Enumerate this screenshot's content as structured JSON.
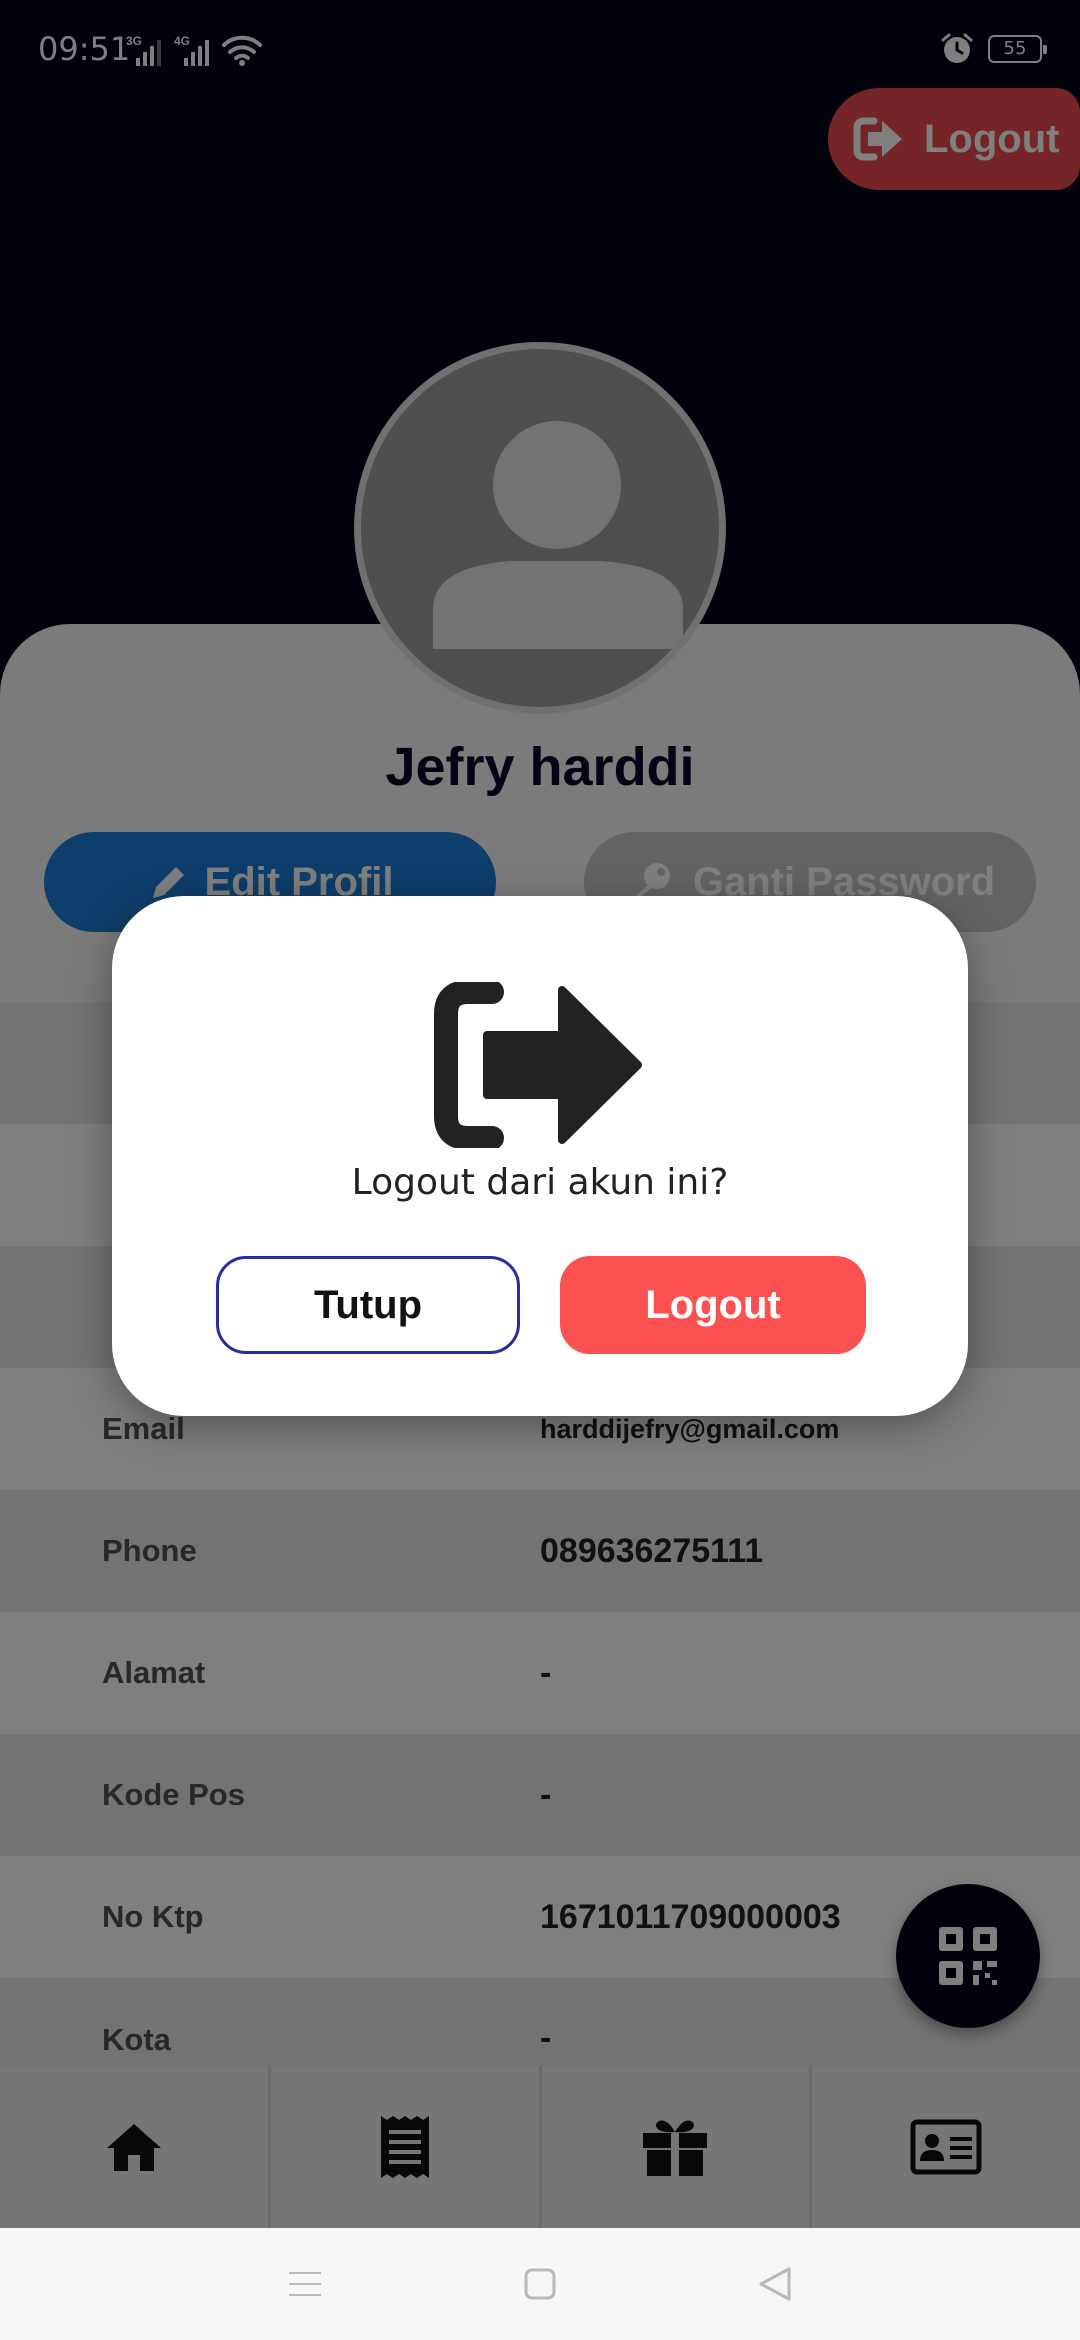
{
  "status_bar": {
    "time": "09:51",
    "network_1": "3G",
    "network_2": "4G",
    "battery": "55"
  },
  "header": {
    "logout_label": "Logout"
  },
  "profile": {
    "name": "Jefry harddi",
    "edit_label": "Edit Profil",
    "password_label": "Ganti Password"
  },
  "info": [
    {
      "label": "Email",
      "value": "harddijefry@gmail.com"
    },
    {
      "label": "Phone",
      "value": "089636275111"
    },
    {
      "label": "Alamat",
      "value": "-"
    },
    {
      "label": "Kode Pos",
      "value": "-"
    },
    {
      "label": "No Ktp",
      "value": "1671011709000003"
    },
    {
      "label": "Kota",
      "value": "-"
    }
  ],
  "bottom_nav": {
    "items": [
      "home-icon",
      "receipt-icon",
      "gift-icon",
      "id-card-icon"
    ]
  },
  "dialog": {
    "message": "Logout dari akun ini?",
    "cancel_label": "Tutup",
    "confirm_label": "Logout"
  },
  "colors": {
    "background": "#020216",
    "logout_red": "#fb5151",
    "edit_blue": "#1c7cd6"
  }
}
